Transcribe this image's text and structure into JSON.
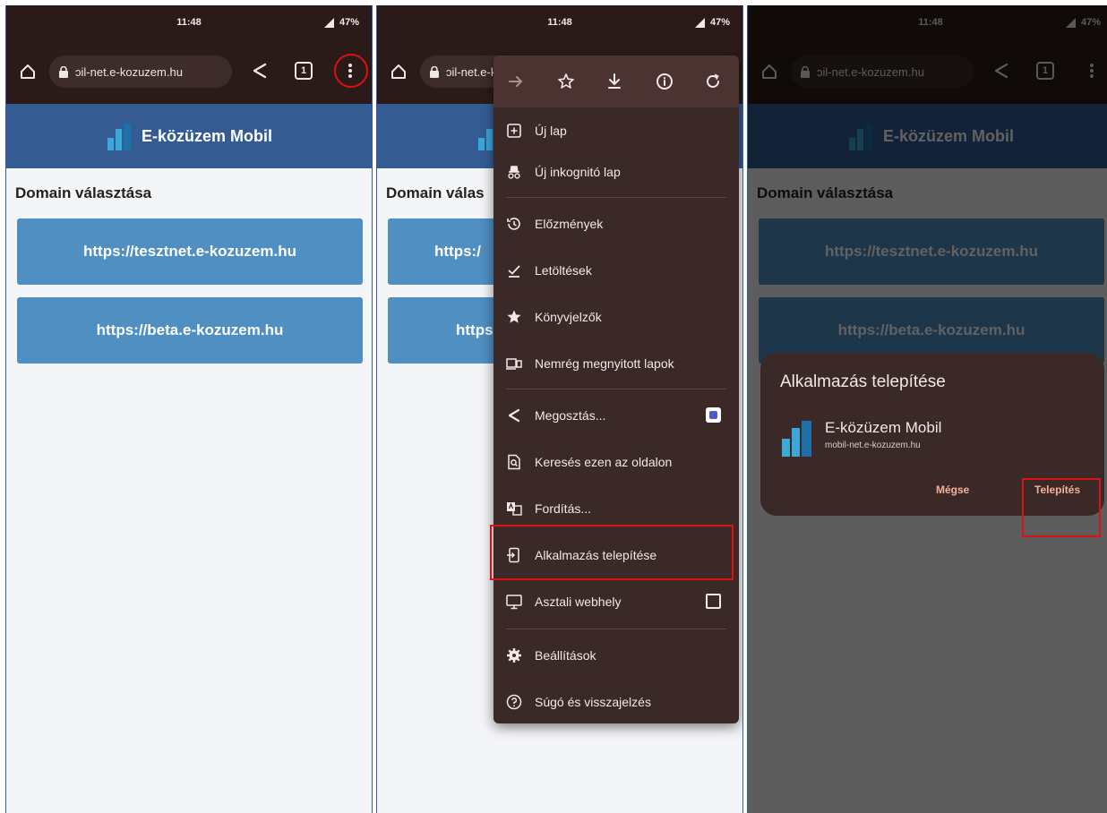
{
  "status": {
    "time": "11:48",
    "battery": "47%"
  },
  "browser": {
    "url": "ɔil-net.e-kozuzem.hu",
    "tab_count": "1"
  },
  "app": {
    "title": "E-közüzem Mobil"
  },
  "page": {
    "section_title": "Domain választása",
    "domains": [
      "https://tesztnet.e-kozuzem.hu",
      "https://beta.e-kozuzem.hu"
    ],
    "domains_truncated": [
      "https:/",
      "https"
    ],
    "section_title_truncated": "Domain válas"
  },
  "menu": {
    "items": [
      {
        "label": "Új lap",
        "icon": "new-tab-icon"
      },
      {
        "label": "Új inkognitó lap",
        "icon": "incognito-icon"
      },
      {
        "label": "Előzmények",
        "icon": "history-icon"
      },
      {
        "label": "Letöltések",
        "icon": "downloads-icon"
      },
      {
        "label": "Könyvjelzők",
        "icon": "star-icon"
      },
      {
        "label": "Nemrég megnyitott lapok",
        "icon": "recent-tabs-icon"
      },
      {
        "label": "Megosztás...",
        "icon": "share-icon"
      },
      {
        "label": "Keresés ezen az oldalon",
        "icon": "find-in-page-icon"
      },
      {
        "label": "Fordítás...",
        "icon": "translate-icon"
      },
      {
        "label": "Alkalmazás telepítése",
        "icon": "install-app-icon"
      },
      {
        "label": "Asztali webhely",
        "icon": "desktop-icon"
      },
      {
        "label": "Beállítások",
        "icon": "settings-icon"
      },
      {
        "label": "Súgó és visszajelzés",
        "icon": "help-icon"
      }
    ]
  },
  "dialog": {
    "title": "Alkalmazás telepítése",
    "app_name": "E-közüzem Mobil",
    "app_url": "mobil-net.e-kozuzem.hu",
    "cancel": "Mégse",
    "install": "Telepítés"
  },
  "colors": {
    "chrome_dark": "#2a1b1a",
    "app_blue": "#345c92",
    "button_blue": "#4f8fc2",
    "highlight_red": "#dd1111",
    "menu_bg": "#3b2927"
  }
}
